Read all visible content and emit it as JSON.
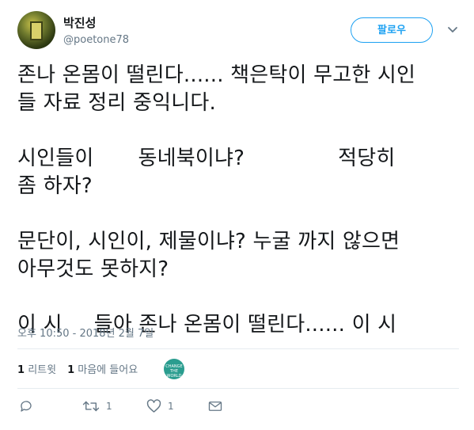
{
  "user": {
    "display_name": "박진성",
    "handle": "@poetone78"
  },
  "follow_button": {
    "label": "팔로우"
  },
  "tweet": {
    "line1": "존나 온몸이 떨린다...... 책은탁이 무고한 시인",
    "line2": "들 자료 정리 중익니다.",
    "line3a": "시인들이",
    "line3b": "동네북이냐?",
    "line3c": "적당히",
    "line4": "좀 하자?",
    "line5": "문단이, 시인이, 제물이냐? 누굴 까지 않으면",
    "line6": "아무것도 못하지?",
    "line7a": "이 시",
    "line7b": "들아 존나 온몸이 떨린다...... 이 시"
  },
  "timestamp": "오후 10:50 - 2018년 2월 7일",
  "stats": {
    "retweet_count": "1",
    "retweet_label": "리트윗",
    "like_count": "1",
    "like_label": "마음에 들어요"
  },
  "liker_avatar_text": "CHANGE THE WORLD",
  "actions": {
    "reply_icon": "reply-icon",
    "retweet_icon": "retweet-icon",
    "retweet_count": "1",
    "like_icon": "heart-icon",
    "like_count": "1",
    "dm_icon": "envelope-icon"
  },
  "colors": {
    "accent": "#1da1f2",
    "text": "#14171a",
    "muted": "#657786",
    "divider": "#e6ecf0"
  }
}
